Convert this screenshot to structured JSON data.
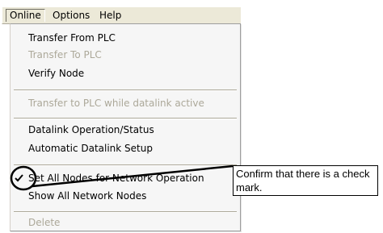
{
  "menubar": {
    "items": [
      {
        "label": "Online",
        "active": true
      },
      {
        "label": "Options",
        "active": false
      },
      {
        "label": "Help",
        "active": false
      }
    ]
  },
  "dropdown": {
    "items": [
      {
        "label": "Transfer From PLC",
        "enabled": true,
        "checked": false
      },
      {
        "label": "Transfer To PLC",
        "enabled": false,
        "checked": false
      },
      {
        "label": "Verify Node",
        "enabled": true,
        "checked": false
      },
      {
        "label": "Transfer to PLC while datalink active",
        "enabled": false,
        "checked": false
      },
      {
        "label": "Datalink Operation/Status",
        "enabled": true,
        "checked": false
      },
      {
        "label": "Automatic Datalink Setup",
        "enabled": true,
        "checked": false
      },
      {
        "label": "Set All Nodes for Network Operation",
        "enabled": true,
        "checked": true
      },
      {
        "label": "Show All Network Nodes",
        "enabled": true,
        "checked": false
      },
      {
        "label": "Delete",
        "enabled": false,
        "checked": false
      }
    ]
  },
  "callout": {
    "text": "Confirm that there is a check mark."
  },
  "colors": {
    "menu_background": "#f6f6f6",
    "menubar_background": "#ece9d8",
    "disabled_text": "#aca899"
  }
}
